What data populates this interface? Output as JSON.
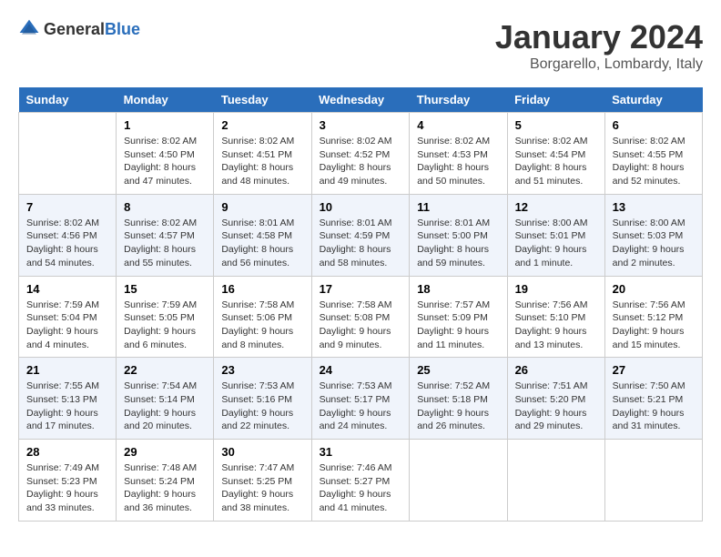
{
  "logo": {
    "general": "General",
    "blue": "Blue"
  },
  "header": {
    "month": "January 2024",
    "location": "Borgarello, Lombardy, Italy"
  },
  "weekdays": [
    "Sunday",
    "Monday",
    "Tuesday",
    "Wednesday",
    "Thursday",
    "Friday",
    "Saturday"
  ],
  "weeks": [
    [
      {
        "day": "",
        "info": ""
      },
      {
        "day": "1",
        "info": "Sunrise: 8:02 AM\nSunset: 4:50 PM\nDaylight: 8 hours\nand 47 minutes."
      },
      {
        "day": "2",
        "info": "Sunrise: 8:02 AM\nSunset: 4:51 PM\nDaylight: 8 hours\nand 48 minutes."
      },
      {
        "day": "3",
        "info": "Sunrise: 8:02 AM\nSunset: 4:52 PM\nDaylight: 8 hours\nand 49 minutes."
      },
      {
        "day": "4",
        "info": "Sunrise: 8:02 AM\nSunset: 4:53 PM\nDaylight: 8 hours\nand 50 minutes."
      },
      {
        "day": "5",
        "info": "Sunrise: 8:02 AM\nSunset: 4:54 PM\nDaylight: 8 hours\nand 51 minutes."
      },
      {
        "day": "6",
        "info": "Sunrise: 8:02 AM\nSunset: 4:55 PM\nDaylight: 8 hours\nand 52 minutes."
      }
    ],
    [
      {
        "day": "7",
        "info": "Sunrise: 8:02 AM\nSunset: 4:56 PM\nDaylight: 8 hours\nand 54 minutes."
      },
      {
        "day": "8",
        "info": "Sunrise: 8:02 AM\nSunset: 4:57 PM\nDaylight: 8 hours\nand 55 minutes."
      },
      {
        "day": "9",
        "info": "Sunrise: 8:01 AM\nSunset: 4:58 PM\nDaylight: 8 hours\nand 56 minutes."
      },
      {
        "day": "10",
        "info": "Sunrise: 8:01 AM\nSunset: 4:59 PM\nDaylight: 8 hours\nand 58 minutes."
      },
      {
        "day": "11",
        "info": "Sunrise: 8:01 AM\nSunset: 5:00 PM\nDaylight: 8 hours\nand 59 minutes."
      },
      {
        "day": "12",
        "info": "Sunrise: 8:00 AM\nSunset: 5:01 PM\nDaylight: 9 hours\nand 1 minute."
      },
      {
        "day": "13",
        "info": "Sunrise: 8:00 AM\nSunset: 5:03 PM\nDaylight: 9 hours\nand 2 minutes."
      }
    ],
    [
      {
        "day": "14",
        "info": "Sunrise: 7:59 AM\nSunset: 5:04 PM\nDaylight: 9 hours\nand 4 minutes."
      },
      {
        "day": "15",
        "info": "Sunrise: 7:59 AM\nSunset: 5:05 PM\nDaylight: 9 hours\nand 6 minutes."
      },
      {
        "day": "16",
        "info": "Sunrise: 7:58 AM\nSunset: 5:06 PM\nDaylight: 9 hours\nand 8 minutes."
      },
      {
        "day": "17",
        "info": "Sunrise: 7:58 AM\nSunset: 5:08 PM\nDaylight: 9 hours\nand 9 minutes."
      },
      {
        "day": "18",
        "info": "Sunrise: 7:57 AM\nSunset: 5:09 PM\nDaylight: 9 hours\nand 11 minutes."
      },
      {
        "day": "19",
        "info": "Sunrise: 7:56 AM\nSunset: 5:10 PM\nDaylight: 9 hours\nand 13 minutes."
      },
      {
        "day": "20",
        "info": "Sunrise: 7:56 AM\nSunset: 5:12 PM\nDaylight: 9 hours\nand 15 minutes."
      }
    ],
    [
      {
        "day": "21",
        "info": "Sunrise: 7:55 AM\nSunset: 5:13 PM\nDaylight: 9 hours\nand 17 minutes."
      },
      {
        "day": "22",
        "info": "Sunrise: 7:54 AM\nSunset: 5:14 PM\nDaylight: 9 hours\nand 20 minutes."
      },
      {
        "day": "23",
        "info": "Sunrise: 7:53 AM\nSunset: 5:16 PM\nDaylight: 9 hours\nand 22 minutes."
      },
      {
        "day": "24",
        "info": "Sunrise: 7:53 AM\nSunset: 5:17 PM\nDaylight: 9 hours\nand 24 minutes."
      },
      {
        "day": "25",
        "info": "Sunrise: 7:52 AM\nSunset: 5:18 PM\nDaylight: 9 hours\nand 26 minutes."
      },
      {
        "day": "26",
        "info": "Sunrise: 7:51 AM\nSunset: 5:20 PM\nDaylight: 9 hours\nand 29 minutes."
      },
      {
        "day": "27",
        "info": "Sunrise: 7:50 AM\nSunset: 5:21 PM\nDaylight: 9 hours\nand 31 minutes."
      }
    ],
    [
      {
        "day": "28",
        "info": "Sunrise: 7:49 AM\nSunset: 5:23 PM\nDaylight: 9 hours\nand 33 minutes."
      },
      {
        "day": "29",
        "info": "Sunrise: 7:48 AM\nSunset: 5:24 PM\nDaylight: 9 hours\nand 36 minutes."
      },
      {
        "day": "30",
        "info": "Sunrise: 7:47 AM\nSunset: 5:25 PM\nDaylight: 9 hours\nand 38 minutes."
      },
      {
        "day": "31",
        "info": "Sunrise: 7:46 AM\nSunset: 5:27 PM\nDaylight: 9 hours\nand 41 minutes."
      },
      {
        "day": "",
        "info": ""
      },
      {
        "day": "",
        "info": ""
      },
      {
        "day": "",
        "info": ""
      }
    ]
  ]
}
